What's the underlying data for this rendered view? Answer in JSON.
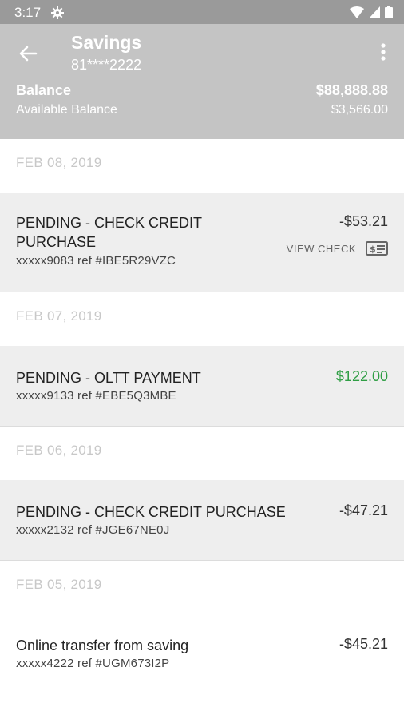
{
  "status_bar": {
    "time": "3:17"
  },
  "header": {
    "title": "Savings",
    "account_number": "81****2222",
    "balance_label": "Balance",
    "balance_value": "$88,888.88",
    "available_label": "Available Balance",
    "available_value": "$3,566.00"
  },
  "transactions": {
    "d1": {
      "date": "FEB 08, 2019"
    },
    "t1": {
      "description": "PENDING - CHECK CREDIT PURCHASE",
      "ref": "xxxxx9083 ref #IBE5R29VZC",
      "amount": "-$53.21",
      "view_check_label": "VIEW CHECK"
    },
    "d2": {
      "date": "FEB 07, 2019"
    },
    "t2": {
      "description": "PENDING - OLTT PAYMENT",
      "ref": "xxxxx9133 ref #EBE5Q3MBE",
      "amount": "$122.00"
    },
    "d3": {
      "date": "FEB 06, 2019"
    },
    "t3": {
      "description": "PENDING - CHECK CREDIT PURCHASE",
      "ref": "xxxxx2132 ref #JGE67NE0J",
      "amount": "-$47.21"
    },
    "d4": {
      "date": "FEB 05, 2019"
    },
    "t4": {
      "description": "Online transfer from saving",
      "ref": "xxxxx4222 ref #UGM673I2P",
      "amount": "-$45.21"
    }
  },
  "colors": {
    "header_bg": "#c4c4c4",
    "status_bg": "#9a9a9a",
    "credit_green": "#2f9e44",
    "row_bg": "#eeeeee"
  },
  "icons": [
    "settings-gear-icon",
    "wifi-icon",
    "signal-icon",
    "battery-icon",
    "back-arrow-icon",
    "more-vert-icon",
    "check-image-icon"
  ]
}
